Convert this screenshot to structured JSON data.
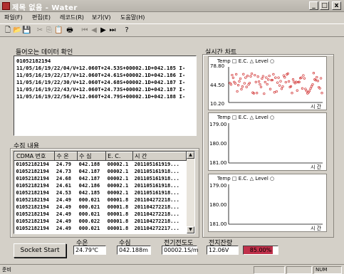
{
  "window": {
    "title": "제목 없음 - Water",
    "min": "_",
    "max": "□",
    "close": "x"
  },
  "menu": [
    "파일(F)",
    "편집(E)",
    "레코드(R)",
    "보기(V)",
    "도움말(H)"
  ],
  "toolbar_icons": [
    "new-icon",
    "open-icon",
    "save-icon",
    "cut-icon",
    "copy-icon",
    "paste-icon",
    "print-icon",
    "first-record-icon",
    "prev-record-icon",
    "next-record-icon",
    "last-record-icon",
    "help-icon"
  ],
  "incoming": {
    "label": "들어오는 데이터 확인",
    "lines": [
      "01052182194",
      "11/05/16/19/22/04/V+12.060T+24.53S+00002.1D+042.185 I-",
      "11/05/16/19/22/17/V+12.060T+24.61S+00002.1D+042.186 I-",
      "11/05/16/19/22/30/V+12.060T+24.68S+00002.1D+042.187 I-",
      "11/05/16/19/22/43/V+12.060T+24.73S+00002.1D+042.187 I-",
      "11/05/16/19/22/56/V+12.060T+24.79S+00002.1D+042.188 I-"
    ]
  },
  "collected": {
    "label": "수집 내용",
    "headers": [
      "CDMA 번호",
      "수 온",
      "수 심",
      "E. C.",
      "시 간"
    ],
    "rows": [
      [
        "01052182194",
        "24.79",
        "042.188",
        "00002.1",
        "201105161919..."
      ],
      [
        "01052182194",
        "24.73",
        "042.187",
        "00002.1",
        "201105161918..."
      ],
      [
        "01052182194",
        "24.68",
        "042.187",
        "00002.1",
        "201105161918..."
      ],
      [
        "01052182194",
        "24.61",
        "042.186",
        "00002.1",
        "201105161918..."
      ],
      [
        "01052182194",
        "24.53",
        "042.185",
        "00002.1",
        "201105161918..."
      ],
      [
        "01052182194",
        "24.49",
        "000.021",
        "00001.8",
        "201104272218..."
      ],
      [
        "01052182194",
        "24.49",
        "000.021",
        "00001.8",
        "201104272218..."
      ],
      [
        "01052182194",
        "24.49",
        "000.021",
        "00001.8",
        "201104272218..."
      ],
      [
        "01052182194",
        "24.49",
        "000.022",
        "00001.8",
        "201104272218..."
      ],
      [
        "01052182194",
        "24.49",
        "000.021",
        "00001.8",
        "201104272217..."
      ],
      [
        "01052182194",
        "24.49",
        "000.021",
        "00001.8",
        "201104272217..."
      ]
    ]
  },
  "realtime": {
    "label": "실시간 차트",
    "legend": "Temp □ E.C. △ Level ○",
    "x_label": "시 간"
  },
  "chart_data": [
    {
      "type": "scatter",
      "legend": [
        "Temp",
        "E.C.",
        "Level"
      ],
      "yticks": [
        "78.80",
        "44.50",
        "10.20"
      ],
      "ylim": [
        10.2,
        78.8
      ],
      "xlabel": "시 간"
    },
    {
      "type": "line",
      "legend": [
        "Temp",
        "E.C.",
        "Level"
      ],
      "yticks": [
        "179.00",
        "180.00",
        "181.00"
      ],
      "xlabel": "시 간"
    },
    {
      "type": "line",
      "legend": [
        "Temp",
        "E.C.",
        "Level"
      ],
      "yticks": [
        "179.00",
        "180.00",
        "181.00"
      ],
      "xlabel": "시 간"
    }
  ],
  "bottom": {
    "socket_button": "Socket Start",
    "water_temp_label": "수온",
    "water_temp_value": "24.79℃",
    "depth_label": "수심",
    "depth_value": "042.188m",
    "ec_label": "전기전도도",
    "ec_value": "00002.1S/m",
    "battery_label": "전지잔량",
    "battery_voltage": "12.06V",
    "battery_percent_text": "85.00%",
    "battery_percent": 85
  },
  "status": {
    "ready": "준비",
    "num": "NUM"
  },
  "colors": {
    "scatter_point": "#d03030",
    "chart_line": "#8a8a8a",
    "battery_fill": "#c0304a"
  }
}
